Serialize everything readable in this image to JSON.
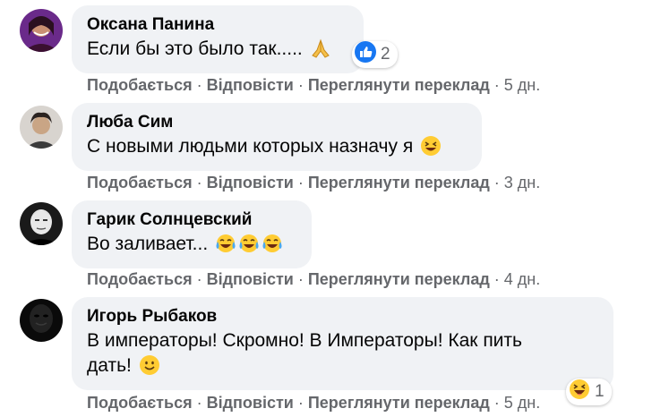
{
  "actions": {
    "like": "Подобається",
    "reply": "Відповісти",
    "translate": "Переглянути переклад",
    "separator": "·"
  },
  "comments": [
    {
      "author": "Оксана Панина",
      "text": "Если бы это было так.....",
      "emoji": [
        "folded-hands-icon"
      ],
      "time": "5 дн.",
      "reaction": {
        "icon": "like-reaction-icon",
        "count": "2"
      }
    },
    {
      "author": "Люба Сим",
      "text": "С новыми людьми которых назначу я",
      "emoji": [
        "laughing-face-icon"
      ],
      "time": "3 дн."
    },
    {
      "author": "Гарик Солнцевский",
      "text": "Во заливает...",
      "emoji": [
        "tears-of-joy-icon",
        "tears-of-joy-icon",
        "tears-of-joy-icon"
      ],
      "time": "4 дн."
    },
    {
      "author": "Игорь Рыбаков",
      "text_line1": "В императоры! Скромно! В Императоры! Как пить",
      "text_line2": "дать!",
      "emoji": [
        "smiling-face-icon"
      ],
      "time": "5 дн.",
      "reaction": {
        "icon": "haha-reaction-icon",
        "count": "1"
      }
    }
  ],
  "colors": {
    "bubble": "#f0f2f5",
    "meta_text": "#65676b",
    "like_blue": "#1877f2",
    "emoji_yellow": "#ffcc33"
  }
}
